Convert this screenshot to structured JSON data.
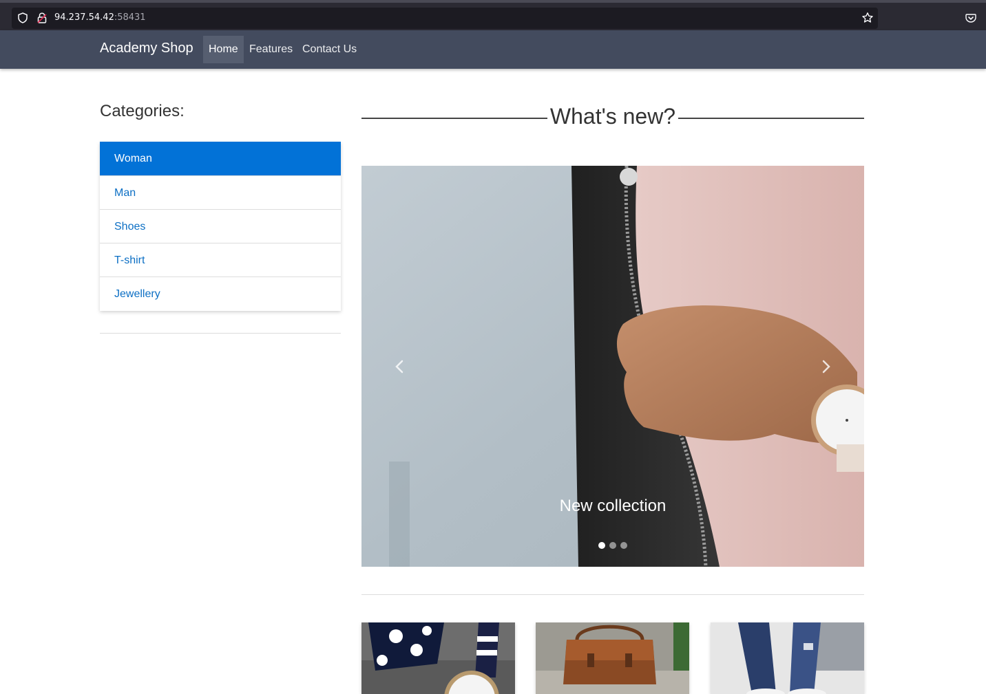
{
  "browser": {
    "url_host": "94.237.54.42",
    "url_port": ":58431"
  },
  "navbar": {
    "brand": "Academy Shop",
    "links": [
      "Home",
      "Features",
      "Contact Us"
    ],
    "active": "Home"
  },
  "sidebar": {
    "title": "Categories:",
    "items": [
      "Woman",
      "Man",
      "Shoes",
      "T-shirt",
      "Jewellery"
    ],
    "active": "Woman"
  },
  "main": {
    "heading": "What's new?",
    "carousel": {
      "caption": "New collection",
      "prev_icon": "chevron-left-icon",
      "next_icon": "chevron-right-icon",
      "slide_count": 3,
      "active_slide": 1
    }
  },
  "colors": {
    "navbar_bg": "#434b5e",
    "active_category": "#0272d7",
    "link": "#0c6fc4"
  }
}
